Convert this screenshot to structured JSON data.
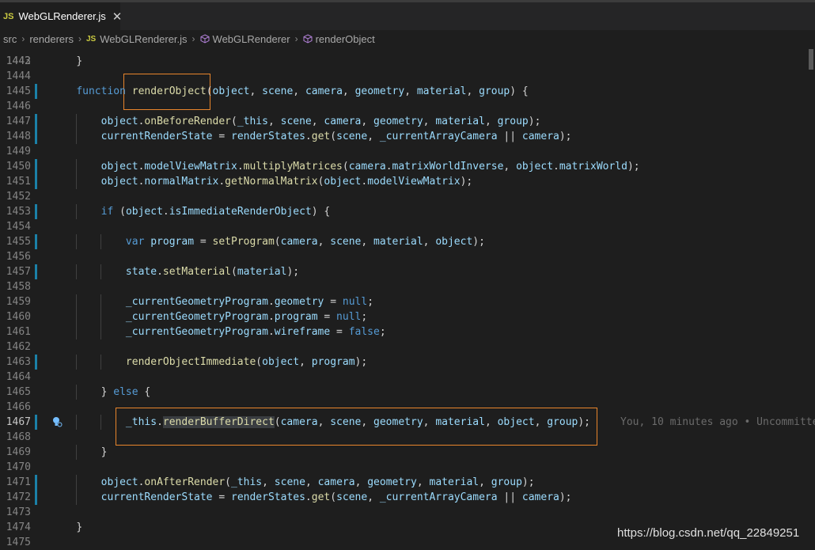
{
  "tab": {
    "icon": "JS",
    "title": "WebGLRenderer.js",
    "close": "✕"
  },
  "breadcrumb": {
    "items": [
      "src",
      "renderers",
      "WebGLRenderer.js",
      "WebGLRenderer",
      "renderObject"
    ],
    "js_icon": "JS"
  },
  "editor": {
    "first_line_partial": "1442",
    "lines": [
      {
        "n": "1443",
        "t": "        }"
      },
      {
        "n": "1444",
        "t": ""
      },
      {
        "n": "1445",
        "t": "        function renderObject(object, scene, camera, geometry, material, group) {"
      },
      {
        "n": "1446",
        "t": ""
      },
      {
        "n": "1447",
        "t": "            object.onBeforeRender(_this, scene, camera, geometry, material, group);"
      },
      {
        "n": "1448",
        "t": "            currentRenderState = renderStates.get(scene, _currentArrayCamera || camera);"
      },
      {
        "n": "1449",
        "t": ""
      },
      {
        "n": "1450",
        "t": "            object.modelViewMatrix.multiplyMatrices(camera.matrixWorldInverse, object.matrixWorld);"
      },
      {
        "n": "1451",
        "t": "            object.normalMatrix.getNormalMatrix(object.modelViewMatrix);"
      },
      {
        "n": "1452",
        "t": ""
      },
      {
        "n": "1453",
        "t": "            if (object.isImmediateRenderObject) {"
      },
      {
        "n": "1454",
        "t": ""
      },
      {
        "n": "1455",
        "t": "                var program = setProgram(camera, scene, material, object);"
      },
      {
        "n": "1456",
        "t": ""
      },
      {
        "n": "1457",
        "t": "                state.setMaterial(material);"
      },
      {
        "n": "1458",
        "t": ""
      },
      {
        "n": "1459",
        "t": "                _currentGeometryProgram.geometry = null;"
      },
      {
        "n": "1460",
        "t": "                _currentGeometryProgram.program = null;"
      },
      {
        "n": "1461",
        "t": "                _currentGeometryProgram.wireframe = false;"
      },
      {
        "n": "1462",
        "t": ""
      },
      {
        "n": "1463",
        "t": "                renderObjectImmediate(object, program);"
      },
      {
        "n": "1464",
        "t": ""
      },
      {
        "n": "1465",
        "t": "            } else {"
      },
      {
        "n": "1466",
        "t": ""
      },
      {
        "n": "1467",
        "t": "                _this.renderBufferDirect(camera, scene, geometry, material, object, group);"
      },
      {
        "n": "1468",
        "t": ""
      },
      {
        "n": "1469",
        "t": "            }"
      },
      {
        "n": "1470",
        "t": ""
      },
      {
        "n": "1471",
        "t": "            object.onAfterRender(_this, scene, camera, geometry, material, group);"
      },
      {
        "n": "1472",
        "t": "            currentRenderState = renderStates.get(scene, _currentArrayCamera || camera);"
      },
      {
        "n": "1473",
        "t": ""
      },
      {
        "n": "1474",
        "t": "        }"
      },
      {
        "n": "1475",
        "t": ""
      }
    ],
    "blame": "You, 10 minutes ago • Uncommitte",
    "active_line": "1467"
  },
  "watermark": "https://blog.csdn.net/qq_22849251",
  "colors": {
    "keyword": "#569cd6",
    "function": "#dcdcaa",
    "variable": "#9cdcfe",
    "highlight_box": "#e8852c",
    "gutter_modified": "#1b81a8"
  }
}
